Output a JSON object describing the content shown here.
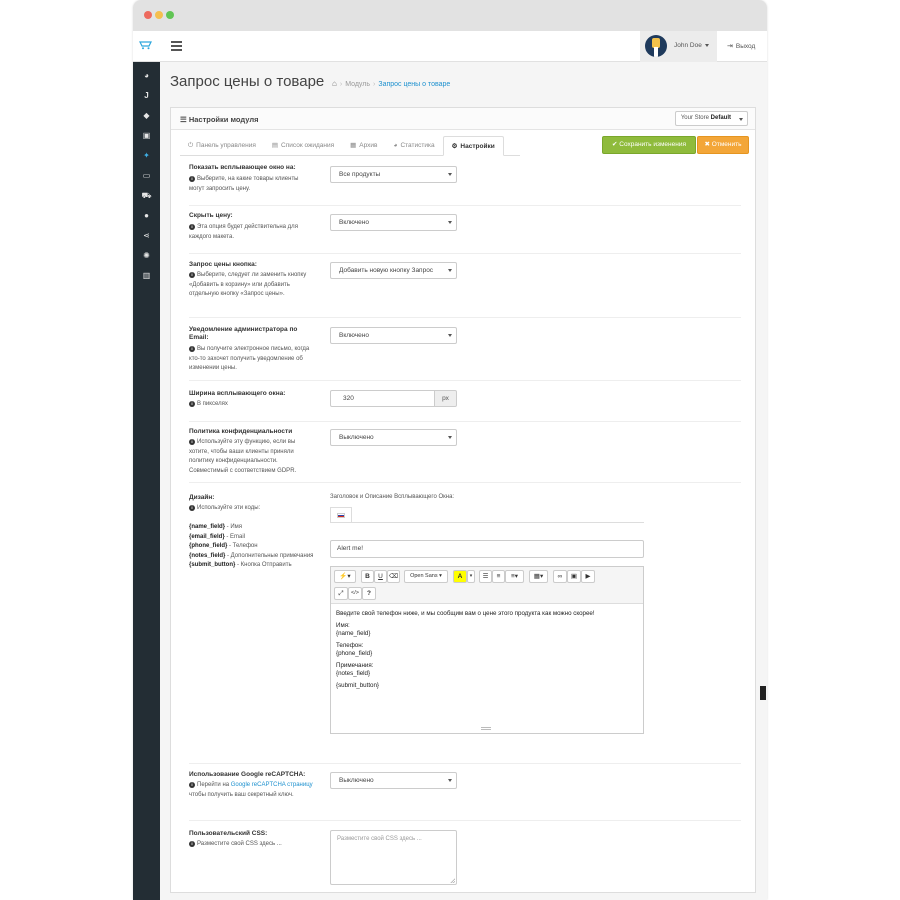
{
  "topbar": {
    "user_name": "John Doe",
    "logout_label": "Выход"
  },
  "sidebar": {
    "icons": [
      "dashboard-icon",
      "catalog-icon",
      "tags-icon",
      "image-icon",
      "extensions-icon",
      "desktop-icon",
      "cart-icon",
      "user-icon",
      "share-icon",
      "settings-icon",
      "reports-icon"
    ],
    "active_index": 4
  },
  "page": {
    "title": "Запрос цены о товаре",
    "breadcrumb": [
      "Модуль",
      "Запрос цены о товаре"
    ]
  },
  "panel": {
    "title": "Настройки модуля",
    "store_prefix": "Your Store",
    "store_value": "Default"
  },
  "tabs": [
    {
      "label": "Панель управления",
      "icon": "⏻"
    },
    {
      "label": "Список ожидания",
      "icon": "▤"
    },
    {
      "label": "Архив",
      "icon": "▦"
    },
    {
      "label": "Статистика",
      "icon": "◕"
    },
    {
      "label": "Настройки",
      "icon": "⚙"
    }
  ],
  "buttons": {
    "save": "Сохранить изменения",
    "cancel": "Отменить"
  },
  "fields": {
    "popup_on": {
      "label": "Показать всплывающее окно на:",
      "help": "Выберите, на какие товары клиенты могут запросить цену.",
      "value": "Все продукты"
    },
    "hide_price": {
      "label": "Скрыть цену:",
      "help": "Эта опция будет действительна для каждого макета.",
      "value": "Включено"
    },
    "price_button": {
      "label": "Запрос цены кнопка:",
      "help": "Выберите, следует ли заменить кнопку «Добавить в корзину» или добавить отдельную кнопку «Запрос цены».",
      "value": "Добавить новую кнопку Запрос"
    },
    "admin_notify": {
      "label": "Уведомление администратора по Email:",
      "help": "Вы получите электронное письмо, когда кто-то захочет получить уведомление об изменении цены.",
      "value": "Включено"
    },
    "popup_width": {
      "label": "Ширина всплывающего окна:",
      "help": "В пикселях",
      "value": "320",
      "unit": "px"
    },
    "privacy": {
      "label": "Политика конфиденциальности",
      "help": "Используйте эту функцию, если вы хотите, чтобы ваши клиенты приняли политику конфиденциальности. Совместимый с соответствием GDPR.",
      "value": "Выключено"
    },
    "design": {
      "label": "Дизайн:",
      "help": "Используйте эти коды:",
      "codes": [
        {
          "code": "{name_field}",
          "desc": " - Имя"
        },
        {
          "code": "{email_field}",
          "desc": " - Email"
        },
        {
          "code": "{phone_field}",
          "desc": " - Телефон"
        },
        {
          "code": "{notes_field}",
          "desc": " - Дополнительные примечания"
        },
        {
          "code": "{submit_button}",
          "desc": " - Кнопка Отправить"
        }
      ],
      "caption": "Заголовок и Описание Всплывающего Окна:",
      "title_value": "Alert me!",
      "font_label": "Open Sans",
      "editor_text": {
        "intro": "Введите свой телефон ниже, и мы сообщим вам о цене этого продукта как можно скорее!",
        "name_label": "Имя:",
        "name_code": "{name_field}",
        "phone_label": "Телефон:",
        "phone_code": "{phone_field}",
        "notes_label": "Примечания:",
        "notes_code": "{notes_field}",
        "submit_code": "{submit_button}"
      }
    },
    "recaptcha": {
      "label": "Использование Google reCAPTCHA:",
      "help_pre": "Перейти на",
      "help_link": "Google reCAPTCHA страницу",
      "help_post": "чтобы получить ваш секретный ключ.",
      "value": "Выключено"
    },
    "custom_css": {
      "label": "Пользовательский CSS:",
      "help": "Разместите свой CSS здесь ...",
      "placeholder": "Разместите свой CSS здесь ..."
    }
  }
}
